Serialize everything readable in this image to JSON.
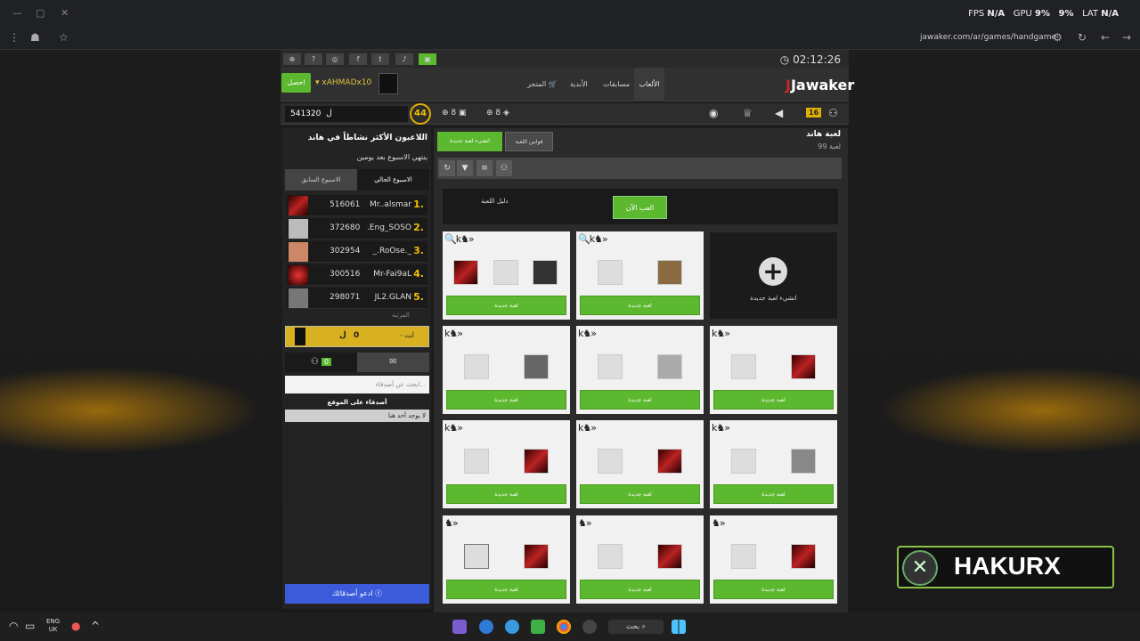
{
  "window": {
    "fps": "FPS",
    "fps_val": "N/A",
    "gpu": "GPU",
    "gpu_val": "9%",
    "cpu_val": "9%",
    "lat": "LAT",
    "lat_val": "N/A",
    "url": "jawaker.com/ar/games/handgame"
  },
  "site": {
    "clock": "02:12:26",
    "logo": "Jawaker",
    "get_button": "احصل",
    "username": "xAHMADx10",
    "nav": {
      "games": "الألعاب",
      "contests": "مسابقات",
      "clubs": "الأندية",
      "store": "المتجر"
    },
    "coins": "541320",
    "level": "44",
    "stat1": "8",
    "stat2": "8",
    "badge": "16"
  },
  "leaderboard": {
    "title": "اللاعبون الأكثر نشاطاً في هاند",
    "subtitle": "ينتهي الاسبوع بعد يومين",
    "tab_current": "الاسبوع الحالي",
    "tab_previous": "الاسبوع السابق",
    "rows": [
      {
        "rank": "1.",
        "name": "Mr..alsmar",
        "score": "516061"
      },
      {
        "rank": "2.",
        "name": ".Eng_SOSO",
        "score": "372680"
      },
      {
        "rank": "3.",
        "name": "_.RoOse._",
        "score": "302954"
      },
      {
        "rank": "4.",
        "name": "Mr-Fai9aL",
        "score": "300516"
      },
      {
        "rank": "5.",
        "name": "JL2.GLAN",
        "score": "298071"
      }
    ],
    "rank_label": "المرتبة",
    "me_label": "- أنت",
    "me_score": "0",
    "coin_sym": "ڶ"
  },
  "chat": {
    "online": "0",
    "search_placeholder": "ابحث عن أصدقاء...",
    "friends_on_site": "أصدقاء على الموقع",
    "no_friends": "لا يوجد أحد هنا",
    "invite": "ادعو أصدقائك"
  },
  "main": {
    "game_title": "لعبة هاند",
    "game_count": "99 لعبة",
    "rules": "قوانين اللعبة",
    "create": "انشىء لعبة جديدة",
    "guide": "دليل اللعبة",
    "play_now": "العب الآن",
    "card_btn": "لعبة جديدة",
    "new_game": "انشيء لعبة جديدة"
  },
  "overlay": {
    "brand": "HAKURX"
  },
  "taskbar": {
    "lang1": "ENG",
    "lang2": "UK",
    "search": "بحث"
  }
}
